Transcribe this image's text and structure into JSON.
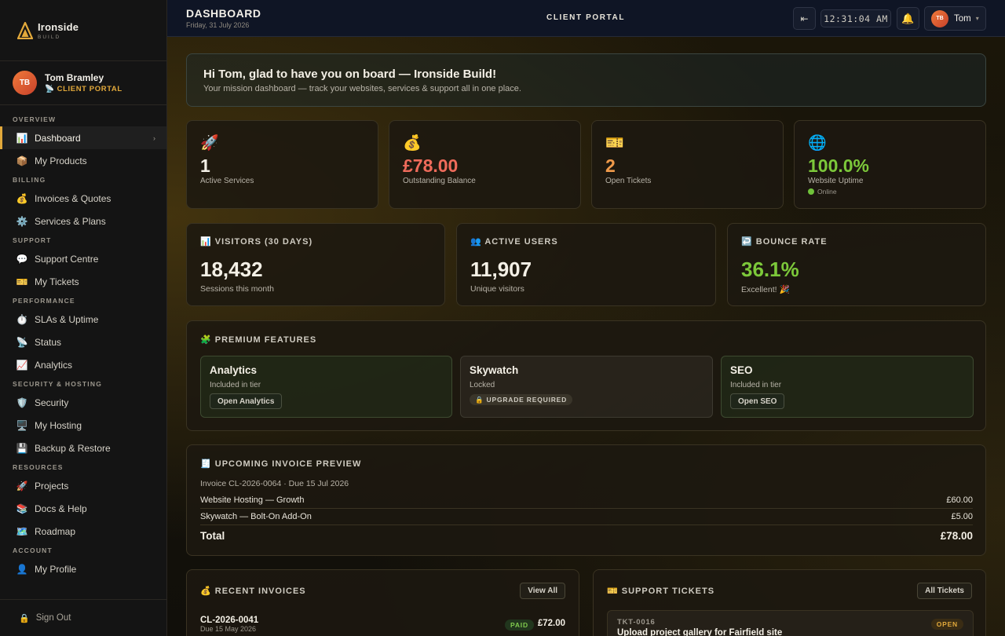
{
  "brand": {
    "name": "Ironside",
    "sub": "BUILD"
  },
  "user": {
    "initials": "TB",
    "name": "Tom Bramley",
    "role": "📡 CLIENT PORTAL",
    "first_name": "Tom"
  },
  "nav": {
    "sections": [
      {
        "label": "OVERVIEW",
        "items": [
          {
            "icon": "📊",
            "label": "Dashboard",
            "active": true
          },
          {
            "icon": "📦",
            "label": "My Products"
          }
        ]
      },
      {
        "label": "BILLING",
        "items": [
          {
            "icon": "💰",
            "label": "Invoices & Quotes"
          },
          {
            "icon": "⚙️",
            "label": "Services & Plans"
          }
        ]
      },
      {
        "label": "SUPPORT",
        "items": [
          {
            "icon": "💬",
            "label": "Support Centre"
          },
          {
            "icon": "🎫",
            "label": "My Tickets"
          }
        ]
      },
      {
        "label": "PERFORMANCE",
        "items": [
          {
            "icon": "⏱️",
            "label": "SLAs & Uptime"
          },
          {
            "icon": "📡",
            "label": "Status"
          },
          {
            "icon": "📈",
            "label": "Analytics"
          }
        ]
      },
      {
        "label": "SECURITY & HOSTING",
        "items": [
          {
            "icon": "🛡️",
            "label": "Security"
          },
          {
            "icon": "🖥️",
            "label": "My Hosting"
          },
          {
            "icon": "💾",
            "label": "Backup & Restore"
          }
        ]
      },
      {
        "label": "RESOURCES",
        "items": [
          {
            "icon": "🚀",
            "label": "Projects"
          },
          {
            "icon": "📚",
            "label": "Docs & Help"
          },
          {
            "icon": "🗺️",
            "label": "Roadmap"
          }
        ]
      },
      {
        "label": "ACCOUNT",
        "items": [
          {
            "icon": "👤",
            "label": "My Profile"
          }
        ]
      }
    ],
    "sign_out": "Sign Out",
    "sign_out_icon": "🔒"
  },
  "header": {
    "title": "DASHBOARD",
    "date": "Friday, 31 July 2026",
    "center": "CLIENT PORTAL",
    "collapse_icon": "⇤",
    "clock": "12:31:04 AM",
    "bell_icon": "🔔",
    "caret": "▾"
  },
  "welcome": {
    "title": "Hi Tom, glad to have you on board — Ironside Build!",
    "subtitle": "Your mission dashboard — track your websites, services & support all in one place."
  },
  "stats": [
    {
      "icon": "🚀",
      "value": "1",
      "label": "Active Services",
      "color": "#f4f0e6"
    },
    {
      "icon": "💰",
      "value": "£78.00",
      "label": "Outstanding Balance",
      "color": "#ef6b5b"
    },
    {
      "icon": "🎫",
      "value": "2",
      "label": "Open Tickets",
      "color": "#f09a4a"
    },
    {
      "icon": "🌐",
      "value": "100.0%",
      "label": "Website Uptime",
      "extra": "Online",
      "color": "#7cc83a"
    }
  ],
  "metrics": [
    {
      "icon": "📊",
      "title": "VISITORS (30 DAYS)",
      "value": "18,432",
      "sub": "Sessions this month",
      "color": "#f4f0e6"
    },
    {
      "icon": "👥",
      "title": "ACTIVE USERS",
      "value": "11,907",
      "sub": "Unique visitors",
      "color": "#f4f0e6"
    },
    {
      "icon": "↩️",
      "title": "BOUNCE RATE",
      "value": "36.1%",
      "sub": "Excellent! 🎉",
      "color": "#7cc83a"
    }
  ],
  "premium": {
    "icon": "🧩",
    "title": "PREMIUM FEATURES",
    "features": [
      {
        "name": "Analytics",
        "desc": "Included in tier",
        "action": "Open Analytics"
      },
      {
        "name": "Skywatch",
        "desc": "Locked",
        "lock": "🔒 UPGRADE REQUIRED"
      },
      {
        "name": "SEO",
        "desc": "Included in tier",
        "action": "Open SEO"
      }
    ]
  },
  "preview": {
    "icon": "🧾",
    "title": "UPCOMING INVOICE PREVIEW",
    "line": "Invoice CL-2026-0064 · Due 15 Jul 2026",
    "rows": [
      {
        "label": "Website Hosting — Growth",
        "amount": "£60.00"
      },
      {
        "label": "Skywatch — Bolt-On Add-On",
        "amount": "£5.00"
      }
    ],
    "total_label": "Total",
    "total_amount": "£78.00"
  },
  "recent_invoices": {
    "icon": "💰",
    "title": "RECENT INVOICES",
    "button": "View All",
    "item": {
      "id": "CL-2026-0041",
      "due": "Due 15 May 2026",
      "status": "PAID",
      "amount": "£72.00"
    }
  },
  "support_tickets": {
    "icon": "🎫",
    "title": "SUPPORT TICKETS",
    "button": "All Tickets",
    "item": {
      "id": "TKT-0016",
      "title": "Upload project gallery for Fairfield site",
      "status": "OPEN"
    }
  }
}
